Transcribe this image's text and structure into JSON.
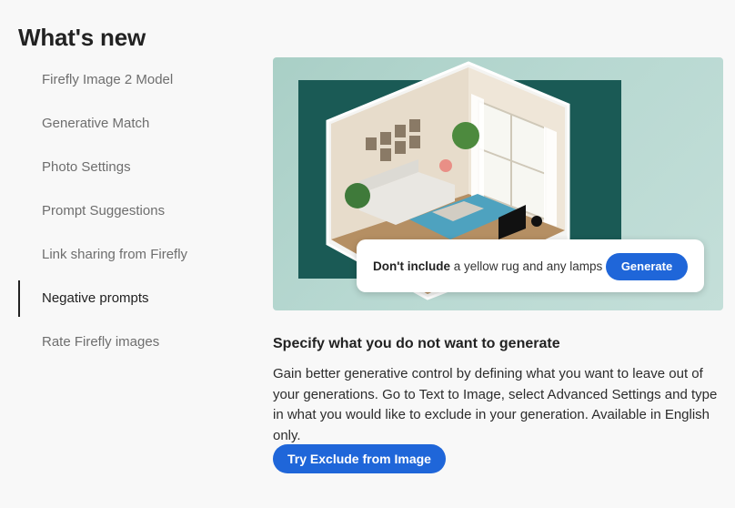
{
  "page": {
    "title": "What's new"
  },
  "nav": {
    "items": [
      {
        "label": "Firefly Image 2 Model",
        "active": false
      },
      {
        "label": "Generative Match",
        "active": false
      },
      {
        "label": "Photo Settings",
        "active": false
      },
      {
        "label": "Prompt Suggestions",
        "active": false
      },
      {
        "label": "Link sharing from Firefly",
        "active": false
      },
      {
        "label": "Negative prompts",
        "active": true
      },
      {
        "label": "Rate Firefly images",
        "active": false
      }
    ]
  },
  "hero": {
    "prompt_bold": "Don't include",
    "prompt_text": " a yellow rug and any lamps",
    "generate_label": "Generate"
  },
  "content": {
    "title": "Specify what you do not want to generate",
    "body": "Gain better generative control by defining what you want to leave out of your generations. Go to Text to Image, select Advanced Settings and type in what you would like to exclude in your generation. Available in English only.",
    "cta_label": "Try Exclude from Image"
  },
  "colors": {
    "accent": "#1f66d9",
    "hero_bg": "#b3d6ce",
    "hero_panel": "#1a5a55"
  }
}
